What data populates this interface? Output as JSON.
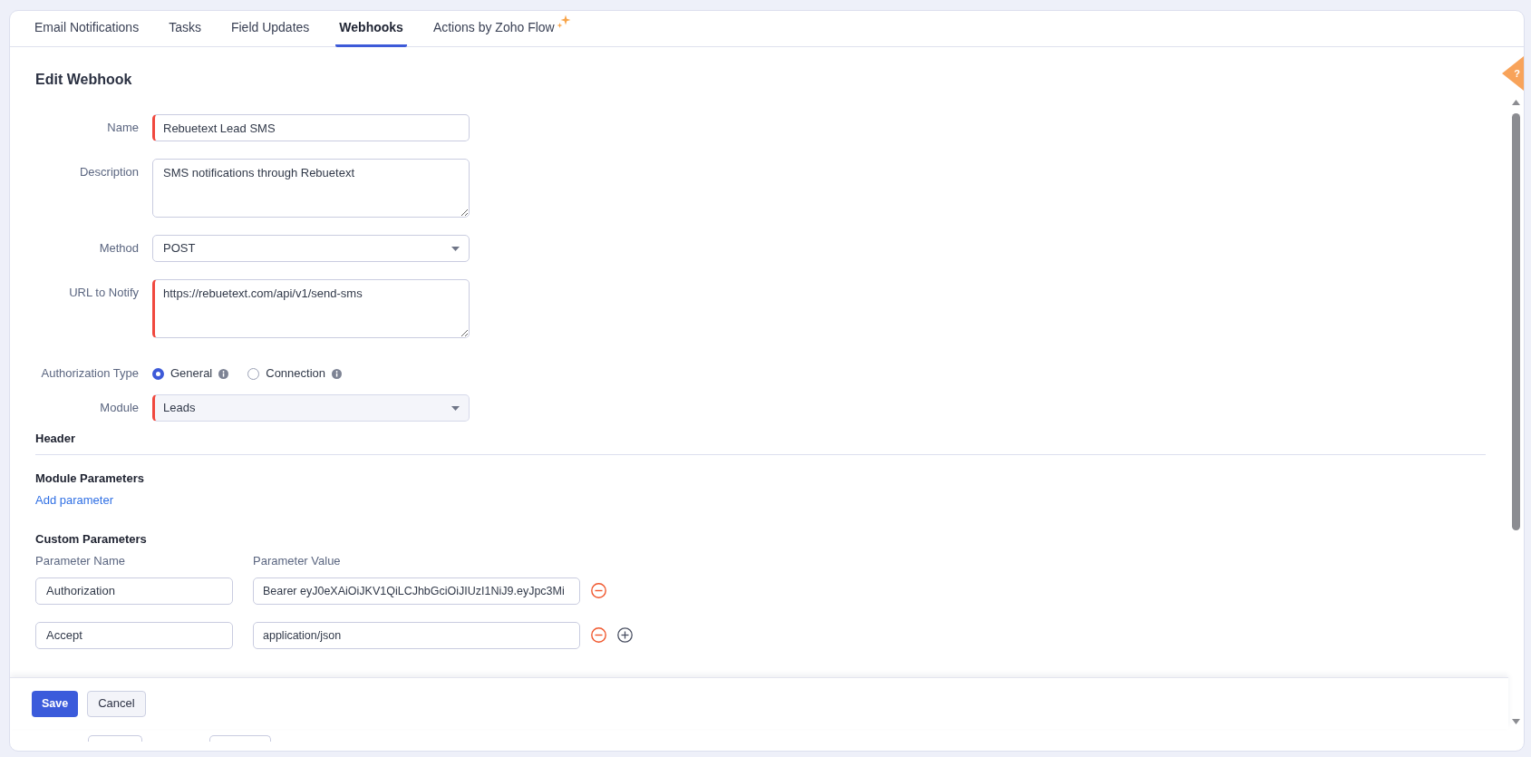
{
  "tabs": [
    {
      "label": "Email Notifications",
      "selected": false,
      "kind": "plain"
    },
    {
      "label": "Tasks",
      "selected": false,
      "kind": "plain"
    },
    {
      "label": "Field Updates",
      "selected": false,
      "kind": "plain"
    },
    {
      "label": "Webhooks",
      "selected": true,
      "kind": "plain"
    },
    {
      "label": "Actions by Zoho Flow",
      "selected": false,
      "kind": "sparkle"
    }
  ],
  "help_tab": {
    "label": "?"
  },
  "form": {
    "title": "Edit Webhook",
    "fields": [
      {
        "kind": "text",
        "label": "Name",
        "value": "Rebuetext Lead SMS",
        "required": true,
        "disabled": false
      },
      {
        "kind": "textarea",
        "label": "Description",
        "value": "SMS notifications through Rebuetext",
        "required": false,
        "disabled": false
      },
      {
        "kind": "select",
        "label": "Method",
        "value": "POST",
        "required": false,
        "disabled": false
      },
      {
        "kind": "textarea",
        "label": "URL to Notify",
        "value": "https://rebuetext.com/api/v1/send-sms",
        "required": true,
        "disabled": false
      },
      {
        "kind": "radio",
        "label": "Authorization Type",
        "options": [
          {
            "label": "General",
            "selected": true
          },
          {
            "label": "Connection",
            "selected": false
          }
        ]
      },
      {
        "kind": "select",
        "label": "Module",
        "value": "Leads",
        "required": true,
        "disabled": true
      }
    ]
  },
  "header": {
    "title": "Header"
  },
  "module_parameters": {
    "title": "Module Parameters",
    "link": "Add parameter"
  },
  "custom_parameters": {
    "title": "Custom Parameters",
    "columns": [
      "Parameter Name",
      "Parameter Value"
    ],
    "rows": [
      {
        "name": "Authorization",
        "value": "Bearer eyJ0eXAiOiJKV1QiLCJhbGciOiJIUzI1NiJ9.eyJpc3Mi"
      },
      {
        "name": "Accept",
        "value": "application/json"
      }
    ]
  },
  "footer": {
    "buttons": [
      {
        "label": "Save",
        "kind": "primary"
      },
      {
        "label": "Cancel",
        "kind": "secondary"
      }
    ]
  }
}
